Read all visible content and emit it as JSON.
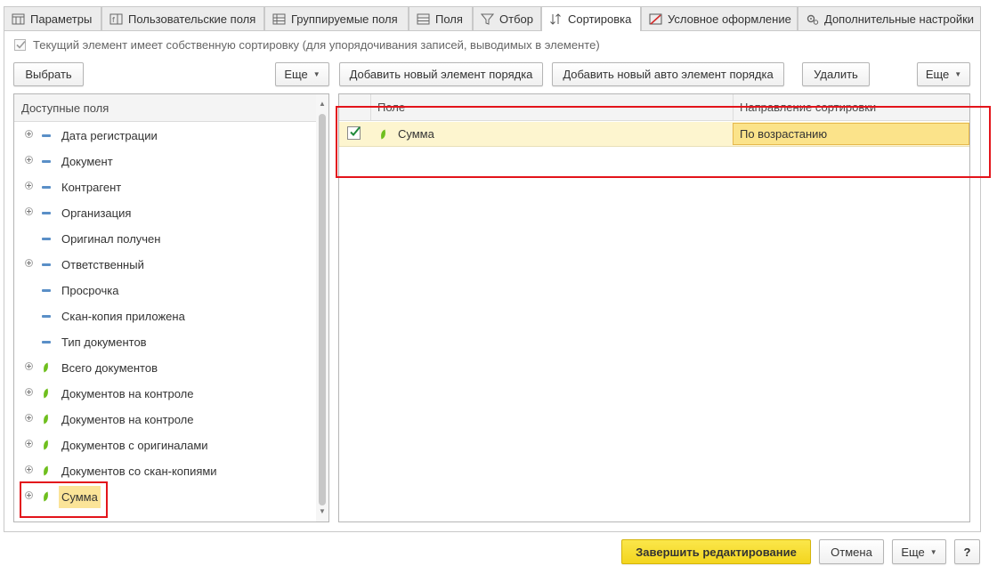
{
  "tabs": [
    {
      "label": "Параметры",
      "icon": "parameters-icon",
      "active": false
    },
    {
      "label": "Пользовательские поля",
      "icon": "custom-fields-icon",
      "active": false
    },
    {
      "label": "Группируемые поля",
      "icon": "grouping-fields-icon",
      "active": false
    },
    {
      "label": "Поля",
      "icon": "fields-icon",
      "active": false
    },
    {
      "label": "Отбор",
      "icon": "filter-icon",
      "active": false
    },
    {
      "label": "Сортировка",
      "icon": "sort-icon",
      "active": true
    },
    {
      "label": "Условное оформление",
      "icon": "conditional-format-icon",
      "active": false
    },
    {
      "label": "Дополнительные настройки",
      "icon": "additional-settings-icon",
      "active": false
    }
  ],
  "own_sort_checkbox": {
    "label": "Текущий элемент имеет собственную сортировку (для  упорядочивания записей, выводимых в элементе)",
    "checked": true
  },
  "left_toolbar": {
    "select_label": "Выбрать",
    "more_label": "Еще"
  },
  "right_toolbar": {
    "add_order_label": "Добавить новый элемент порядка",
    "add_auto_label": "Добавить новый авто элемент порядка",
    "delete_label": "Удалить",
    "more_label": "Еще"
  },
  "available_fields": {
    "header": "Доступные поля",
    "items": [
      {
        "label": "Дата регистрации",
        "expandable": true,
        "icon": "dimension-icon"
      },
      {
        "label": "Документ",
        "expandable": true,
        "icon": "dimension-icon"
      },
      {
        "label": "Контрагент",
        "expandable": true,
        "icon": "dimension-icon"
      },
      {
        "label": "Организация",
        "expandable": true,
        "icon": "dimension-icon"
      },
      {
        "label": "Оригинал получен",
        "expandable": false,
        "icon": "dimension-icon"
      },
      {
        "label": "Ответственный",
        "expandable": true,
        "icon": "dimension-icon"
      },
      {
        "label": "Просрочка",
        "expandable": false,
        "icon": "dimension-icon"
      },
      {
        "label": "Скан-копия приложена",
        "expandable": false,
        "icon": "dimension-icon"
      },
      {
        "label": "Тип документов",
        "expandable": false,
        "icon": "dimension-icon"
      },
      {
        "label": "Всего документов",
        "expandable": true,
        "icon": "resource-icon"
      },
      {
        "label": "Документов на контроле",
        "expandable": true,
        "icon": "resource-icon"
      },
      {
        "label": "Документов на контроле",
        "expandable": true,
        "icon": "resource-icon"
      },
      {
        "label": "Документов с оригиналами",
        "expandable": true,
        "icon": "resource-icon"
      },
      {
        "label": "Документов со скан-копиями",
        "expandable": true,
        "icon": "resource-icon"
      },
      {
        "label": "Сумма",
        "expandable": true,
        "icon": "resource-icon",
        "selected": true
      }
    ]
  },
  "sort_grid": {
    "columns": [
      "Поле",
      "Направление сортировки"
    ],
    "rows": [
      {
        "checked": true,
        "field": "Сумма",
        "direction": "По возрастанию"
      }
    ]
  },
  "footer": {
    "finish_label": "Завершить редактирование",
    "cancel_label": "Отмена",
    "more_label": "Еще",
    "help_label": "?"
  },
  "colors": {
    "accent_yellow": "#f9e03a",
    "selection": "#fbe38a",
    "highlight_frame": "#e3141b",
    "resource_green": "#6fbf1e",
    "dimension_blue": "#5a8fc7"
  }
}
